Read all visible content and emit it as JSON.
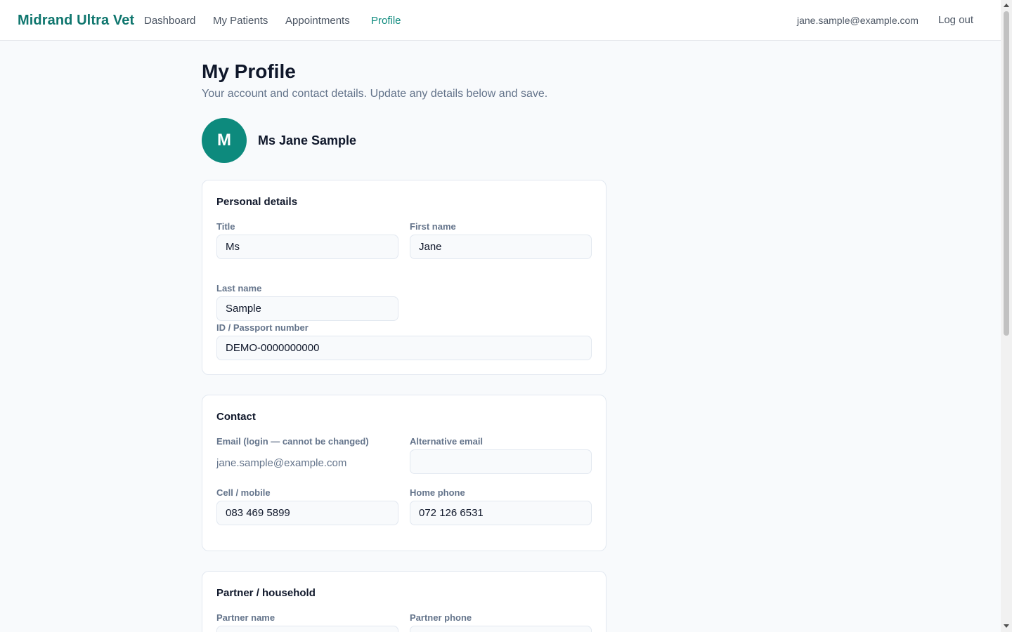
{
  "header": {
    "brand": "Midrand Ultra Vet",
    "nav": [
      {
        "label": "Dashboard",
        "active": false
      },
      {
        "label": "My Patients",
        "active": false
      },
      {
        "label": "Appointments",
        "active": false
      },
      {
        "label": "Profile",
        "active": true
      }
    ],
    "user_email": "jane.sample@example.com",
    "logout_label": "Log out"
  },
  "page": {
    "title": "My Profile",
    "subtitle": "Your account and contact details. Update any details below and save.",
    "avatar_initial": "M",
    "display_name": "Ms Jane Sample"
  },
  "personal": {
    "heading": "Personal details",
    "title_label": "Title",
    "title_value": "Ms",
    "first_name_label": "First name",
    "first_name_value": "Jane",
    "last_name_label": "Last name",
    "last_name_value": "Sample",
    "id_label": "ID / Passport number",
    "id_value": "DEMO-0000000000"
  },
  "contact": {
    "heading": "Contact",
    "email_label": "Email (login — cannot be changed)",
    "email_value": "jane.sample@example.com",
    "alt_email_label": "Alternative email",
    "alt_email_value": "",
    "cell_label": "Cell / mobile",
    "cell_value": "083 469 5899",
    "home_label": "Home phone",
    "home_value": "072 126 6531"
  },
  "partner": {
    "heading": "Partner / household",
    "name_label": "Partner name",
    "name_value": "",
    "phone_label": "Partner phone",
    "phone_value": ""
  },
  "colors": {
    "accent": "#0d8a7d",
    "brand": "#0f766e"
  }
}
